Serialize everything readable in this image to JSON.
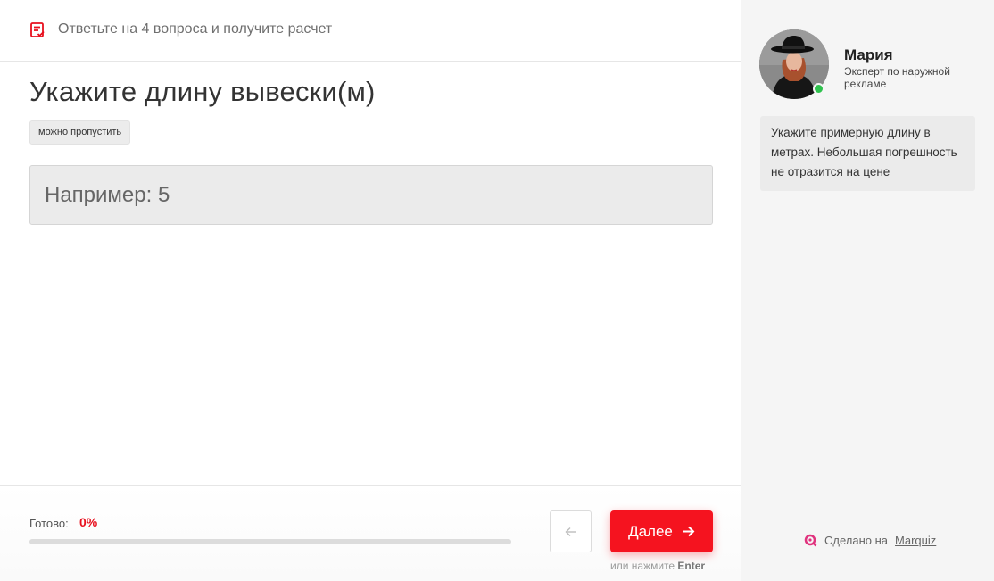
{
  "header": {
    "hint": "Ответьте на 4 вопроса и получите расчет",
    "icon": "list-check-icon"
  },
  "question": {
    "title": "Укажите длину вывески(м)",
    "skip_badge": "можно пропустить",
    "input_value": "",
    "input_placeholder": "Например: 5"
  },
  "footer": {
    "progress_label": "Готово:",
    "progress_value": "0%",
    "progress_fraction": 0,
    "back_icon": "arrow-left-icon",
    "next_label": "Далее",
    "next_icon": "arrow-right-icon",
    "enter_hint_prefix": "или нажмите",
    "enter_hint_key": "Enter"
  },
  "expert": {
    "name": "Мария",
    "role": "Эксперт по наружной рекламе",
    "message": "Укажите примерную длину в метрах. Небольшая погрешность не отразится на цене"
  },
  "branding": {
    "prefix": "Сделано на",
    "link": "Marquiz"
  },
  "colors": {
    "accent": "#f5131f",
    "online": "#2fc24e",
    "side_bg": "#f5f5f5"
  }
}
